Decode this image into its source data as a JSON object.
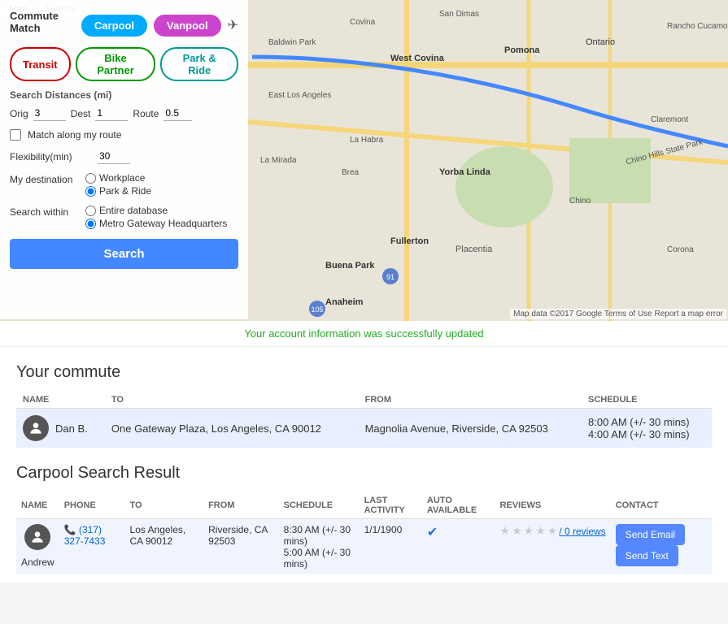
{
  "map": {
    "tabs": [
      "Map",
      "Satellite"
    ],
    "active_tab": "Map",
    "attribution": "Map data ©2017 Google  Terms of Use  Report a map error"
  },
  "sidebar": {
    "commute_match_label": "Commute Match",
    "btn_carpool": "Carpool",
    "btn_vanpool": "Vanpool",
    "btn_transit": "Transit",
    "btn_bike_partner": "Bike Partner",
    "btn_park_ride": "Park & Ride",
    "search_distances_label": "Search Distances (mi)",
    "orig_label": "Orig",
    "orig_value": "3",
    "dest_label": "Dest",
    "dest_value": "1",
    "route_label": "Route",
    "route_value": "0.5",
    "match_route_label": "Match along my route",
    "flexibility_label": "Flexibility(min)",
    "flexibility_value": "30",
    "my_destination_label": "My destination",
    "dest_options": [
      "Workplace",
      "Park & Ride"
    ],
    "dest_selected": "Park & Ride",
    "search_within_label": "Search within",
    "search_within_options": [
      "Entire database",
      "Metro Gateway Headquarters"
    ],
    "search_within_selected": "Metro Gateway Headquarters",
    "search_btn": "Search"
  },
  "success_message": "Your account information was successfully updated",
  "your_commute": {
    "title": "Your commute",
    "headers": [
      "NAME",
      "TO",
      "FROM",
      "SCHEDULE"
    ],
    "row": {
      "name": "Dan B.",
      "to": "One Gateway Plaza, Los Angeles, CA 90012",
      "from": "Magnolia Avenue, Riverside, CA 92503",
      "schedule_line1": "8:00 AM (+/- 30 mins)",
      "schedule_line2": "4:00 AM (+/- 30 mins)"
    }
  },
  "carpool_search": {
    "title": "Carpool Search Result",
    "headers": [
      "NAME",
      "PHONE",
      "TO",
      "FROM",
      "SCHEDULE",
      "LAST ACTIVITY",
      "AUTO AVAILABLE",
      "REVIEWS",
      "CONTACT"
    ],
    "row": {
      "name": "Andrew",
      "phone": "(317) 327-7433",
      "to": "Los Angeles, CA 90012",
      "from": "Riverside, CA 92503",
      "schedule_line1": "8:30 AM (+/- 30 mins)",
      "schedule_line2": "5:00 AM (+/- 30 mins)",
      "last_activity": "1/1/1900",
      "auto_available": true,
      "reviews_count": "/ 0 reviews",
      "stars": 5,
      "btn_email": "Send Email",
      "btn_text": "Send Text"
    }
  }
}
